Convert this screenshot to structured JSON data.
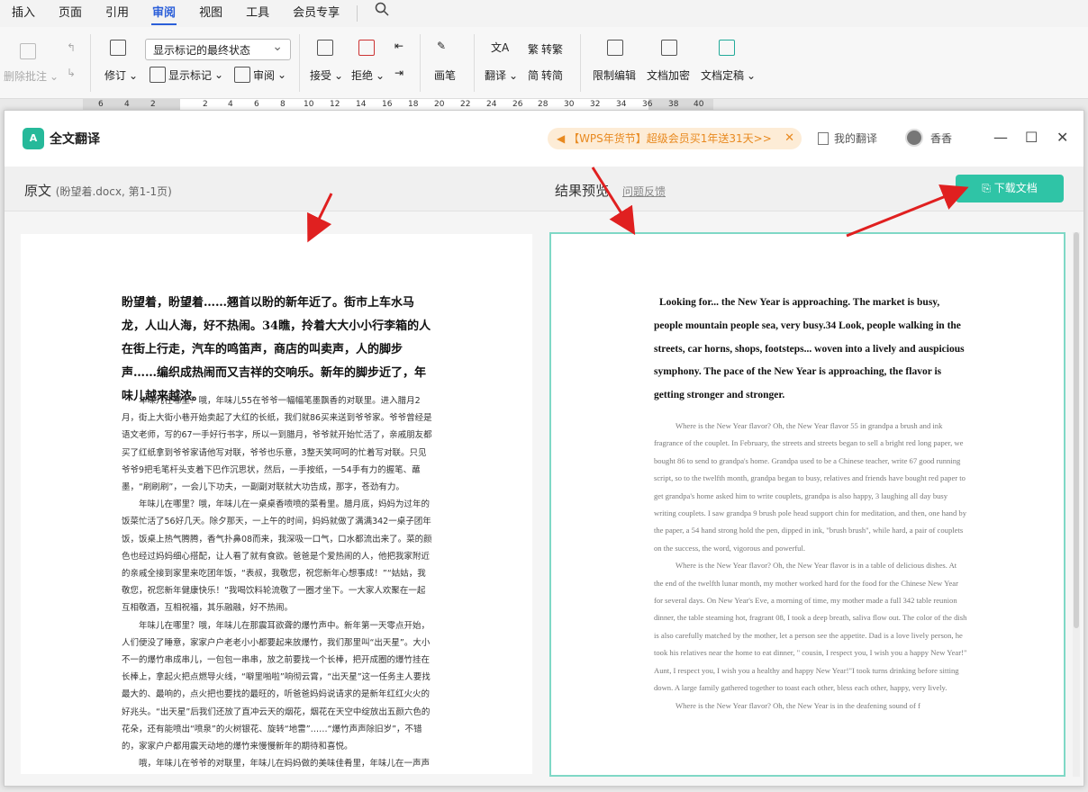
{
  "menubar": {
    "items": [
      "插入",
      "页面",
      "引用",
      "审阅",
      "视图",
      "工具",
      "会员专享"
    ],
    "active_index": 3,
    "search_icon": "search-icon"
  },
  "toolbar": {
    "delete_comment": "删除批注",
    "track": "修订",
    "markup_select": "显示标记的最终状态",
    "show_markup": "显示标记",
    "review": "审阅",
    "accept": "接受",
    "reject": "拒绝",
    "pen": "画笔",
    "translate": "翻译",
    "to_traditional": "转繁",
    "to_simplified": "转简",
    "restrict_edit": "限制编辑",
    "doc_encrypt": "文档加密",
    "doc_finalize": "文档定稿"
  },
  "ruler": {
    "ticks": [
      "6",
      "4",
      "2",
      "2",
      "4",
      "6",
      "8",
      "10",
      "12",
      "14",
      "16",
      "18",
      "20",
      "22",
      "24",
      "26",
      "28",
      "30",
      "32",
      "34",
      "36",
      "38",
      "40"
    ]
  },
  "dialog": {
    "logo_text": "A",
    "title": "全文翻译",
    "promo": "【WPS年货节】超级会员买1年送31天>>",
    "my_translation": "我的翻译",
    "user_name": "香香",
    "original_label": "原文",
    "original_file": "(盼望着.docx, 第1-1页)",
    "result_label": "结果预览",
    "feedback": "问题反馈",
    "download": "下载文档"
  },
  "original": {
    "heading": "盼望着，盼望着……翘首以盼的新年近了。街市上车水马龙，人山人海，好不热闹。34瞧，拎着大大小小行李箱的人在街上行走，汽车的鸣笛声，商店的叫卖声，人的脚步声……编织成热闹而又吉祥的交响乐。新年的脚步近了，年味儿越来越浓。",
    "paragraphs": [
      "年味儿在哪里？哦，年味儿55在爷爷一幅幅笔墨飘香的对联里。进入腊月2月，街上大街小巷开始卖起了大红的长纸，我们就86买来送到爷爷家。爷爷曾经是语文老师，写的67一手好行书字，所以一到腊月，爷爷就开始忙活了，亲戚朋友都买了红纸拿到爷爷家请他写对联，爷爷也乐意，3整天笑呵呵的忙着写对联。只见爷爷9把毛笔杆头支着下巴作沉思状，然后，一手按纸，一54手有力的握笔、蘸墨，“刷刷刷”，一会儿下功夫，一副副对联就大功告成，那字，苍劲有力。",
      "年味儿在哪里？哦，年味儿在一桌桌香喷喷的菜肴里。腊月底，妈妈为过年的饭菜忙活了56好几天。除夕那天，一上午的时间，妈妈就做了满满342一桌子团年饭，饭桌上热气腾腾，香气扑鼻08而来，我深吸一口气，口水都流出来了。菜的颜色也经过妈妈细心搭配，让人看了就有食欲。爸爸是个爱热闹的人，他把我家附近的亲戚全接到家里来吃团年饭，“表叔，我敬您，祝您新年心想事成！”“姑姑，我敬您，祝您新年健康快乐！”我喝饮料轮流敬了一圈才坐下。一大家人欢聚在一起互相敬酒，互相祝福，其乐融融，好不热闹。",
      "年味儿在哪里？哦，年味儿在那震耳欲聋的爆竹声中。新年第一天零点开始，人们便没了睡意，家家户户老老小小都要起来放爆竹，我们那里叫“出天星”。大小不一的爆竹串成串儿，一包包一串串，放之前要找一个长棒，把开成圈的爆竹挂在长棒上，拿起火把点燃导火线，“噼里啪啦”响彻云霄，“出天星”这一任务主人要找最大的、最响的，点火把也要找的最旺的，听爸爸妈妈说请求的是新年红红火火的好兆头。“出天星”后我们还放了直冲云天的烟花，烟花在天空中绽放出五颜六色的花朵，还有能喷出“喷泉”的火树银花、旋转“地雷”……“爆竹声声除旧岁”，不错的，家家户户都用震天动地的爆竹来慢慢新年的期待和喜悦。",
      "哦，年味儿在爷爷的对联里，年味儿在妈妈做的美味佳肴里，年味儿在一声声"
    ]
  },
  "translated": {
    "heading": "Looking for... the New Year is approaching. The market is busy, people mountain people sea, very busy.34 Look, people walking in the streets, car horns, shops, footsteps... woven into a lively and auspicious symphony. The pace of the New Year is approaching, the flavor is getting stronger and stronger.",
    "paragraphs": [
      "Where is the New Year flavor? Oh, the New Year flavor 55 in grandpa a brush and ink fragrance of the couplet. In February, the streets and streets began to sell a bright red long paper, we bought 86 to send to grandpa's home. Grandpa used to be a Chinese teacher, write 67 good running script, so to the twelfth month, grandpa began to busy, relatives and friends have bought red paper to get grandpa's home asked him to write couplets, grandpa is also happy, 3 laughing all day busy writing couplets. I saw grandpa 9 brush pole head support chin for meditation, and then, one hand by the paper, a 54 hand strong hold the pen, dipped in ink, \"brush brush\", while hard, a pair of couplets on the success, the word, vigorous and powerful.",
      "Where is the New Year flavor? Oh, the New Year flavor is in a table of delicious dishes. At the end of the twelfth lunar month, my mother worked hard for the food for the Chinese New Year for several days. On New Year's Eve, a morning of time, my mother made a full 342 table reunion dinner, the table steaming hot, fragrant 08, I took a deep breath, saliva flow out. The color of the dish is also carefully matched by the mother, let a person see the appetite. Dad is a love lively person, he took his relatives near the home to eat dinner, \" cousin, I respect you, I wish you a happy New Year!\" Aunt, I respect you, I wish you a healthy and happy New Year!\"I took turns drinking before sitting down. A large family gathered together to toast each other, bless each other, happy, very lively.",
      "Where is the New Year flavor? Oh, the New Year is in the deafening sound of f"
    ]
  }
}
